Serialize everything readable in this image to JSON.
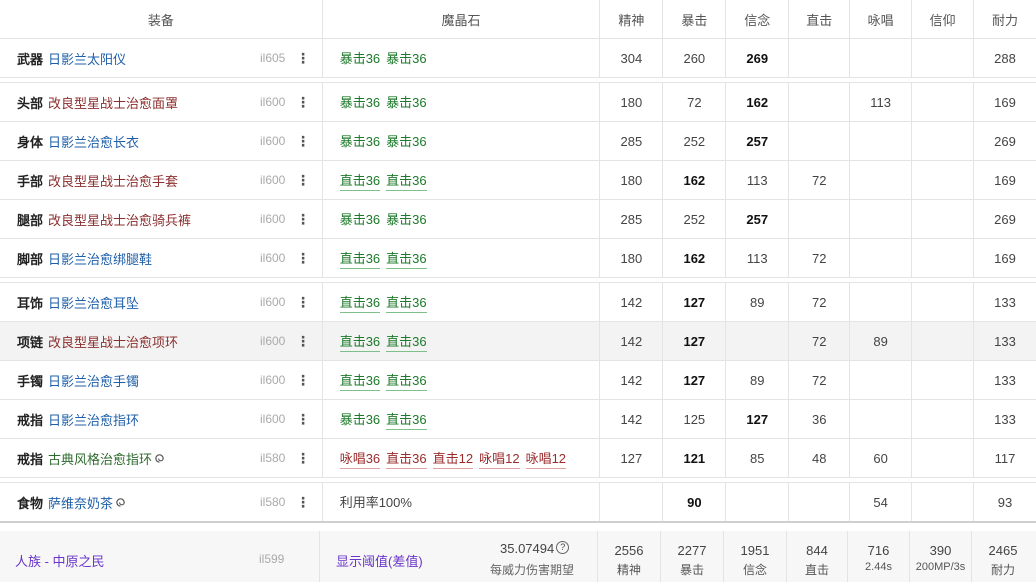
{
  "header": {
    "gear": "装备",
    "materia": "魔晶石",
    "stats": [
      "精神",
      "暴击",
      "信念",
      "直击",
      "咏唱",
      "信仰",
      "耐力"
    ]
  },
  "rows": [
    {
      "slot": "武器",
      "name": "日影兰太阳仪",
      "color": "blue",
      "ilvl": "il605",
      "materia": [
        {
          "t": "暴击36",
          "k": "crit"
        },
        {
          "t": "暴击36",
          "k": "crit"
        }
      ],
      "stats": [
        "304",
        "260",
        "269",
        "",
        "",
        "",
        "288"
      ],
      "bold": [
        2
      ]
    },
    {
      "slot": "头部",
      "name": "改良型星战士治愈面罩",
      "color": "red",
      "ilvl": "il600",
      "materia": [
        {
          "t": "暴击36",
          "k": "crit"
        },
        {
          "t": "暴击36",
          "k": "crit"
        }
      ],
      "stats": [
        "180",
        "72",
        "162",
        "",
        "113",
        "",
        "169"
      ],
      "bold": [
        2
      ]
    },
    {
      "slot": "身体",
      "name": "日影兰治愈长衣",
      "color": "blue",
      "ilvl": "il600",
      "materia": [
        {
          "t": "暴击36",
          "k": "crit"
        },
        {
          "t": "暴击36",
          "k": "crit"
        }
      ],
      "stats": [
        "285",
        "252",
        "257",
        "",
        "",
        "",
        "269"
      ],
      "bold": [
        2
      ]
    },
    {
      "slot": "手部",
      "name": "改良型星战士治愈手套",
      "color": "red",
      "ilvl": "il600",
      "materia": [
        {
          "t": "直击36",
          "k": "dh"
        },
        {
          "t": "直击36",
          "k": "dh"
        }
      ],
      "stats": [
        "180",
        "162",
        "113",
        "72",
        "",
        "",
        "169"
      ],
      "bold": [
        1
      ]
    },
    {
      "slot": "腿部",
      "name": "改良型星战士治愈骑兵裤",
      "color": "red",
      "ilvl": "il600",
      "materia": [
        {
          "t": "暴击36",
          "k": "crit"
        },
        {
          "t": "暴击36",
          "k": "crit"
        }
      ],
      "stats": [
        "285",
        "252",
        "257",
        "",
        "",
        "",
        "269"
      ],
      "bold": [
        2
      ]
    },
    {
      "slot": "脚部",
      "name": "日影兰治愈绑腿鞋",
      "color": "blue",
      "ilvl": "il600",
      "materia": [
        {
          "t": "直击36",
          "k": "dh"
        },
        {
          "t": "直击36",
          "k": "dh"
        }
      ],
      "stats": [
        "180",
        "162",
        "113",
        "72",
        "",
        "",
        "169"
      ],
      "bold": [
        1
      ]
    },
    {
      "slot": "耳饰",
      "name": "日影兰治愈耳坠",
      "color": "blue",
      "ilvl": "il600",
      "materia": [
        {
          "t": "直击36",
          "k": "dh"
        },
        {
          "t": "直击36",
          "k": "dh"
        }
      ],
      "stats": [
        "142",
        "127",
        "89",
        "72",
        "",
        "",
        "133"
      ],
      "bold": [
        1
      ]
    },
    {
      "slot": "项链",
      "name": "改良型星战士治愈项环",
      "color": "red",
      "ilvl": "il600",
      "materia": [
        {
          "t": "直击36",
          "k": "dh"
        },
        {
          "t": "直击36",
          "k": "dh"
        }
      ],
      "stats": [
        "142",
        "127",
        "",
        "72",
        "89",
        "",
        "133"
      ],
      "bold": [
        1
      ],
      "highlight": true
    },
    {
      "slot": "手镯",
      "name": "日影兰治愈手镯",
      "color": "blue",
      "ilvl": "il600",
      "materia": [
        {
          "t": "直击36",
          "k": "dh"
        },
        {
          "t": "直击36",
          "k": "dh"
        }
      ],
      "stats": [
        "142",
        "127",
        "89",
        "72",
        "",
        "",
        "133"
      ],
      "bold": [
        1
      ]
    },
    {
      "slot": "戒指",
      "name": "日影兰治愈指环",
      "color": "blue",
      "ilvl": "il600",
      "materia": [
        {
          "t": "暴击36",
          "k": "crit"
        },
        {
          "t": "直击36",
          "k": "dh"
        }
      ],
      "stats": [
        "142",
        "125",
        "127",
        "36",
        "",
        "",
        "133"
      ],
      "bold": [
        2
      ]
    },
    {
      "slot": "戒指",
      "name": "古典风格治愈指环",
      "color": "green",
      "ilvl": "il580",
      "swirl": true,
      "materia": [
        {
          "t": "咏唱36",
          "k": "red"
        },
        {
          "t": "直击36",
          "k": "red"
        },
        {
          "t": "直击12",
          "k": "red"
        },
        {
          "t": "咏唱12",
          "k": "red"
        },
        {
          "t": "咏唱12",
          "k": "red"
        }
      ],
      "stats": [
        "127",
        "121",
        "85",
        "48",
        "60",
        "",
        "117"
      ],
      "bold": [
        1
      ]
    }
  ],
  "food": {
    "slot": "食物",
    "name": "萨维奈奶茶",
    "ilvl": "il580",
    "materia_text": "利用率100%",
    "stats": [
      "",
      "90",
      "",
      "",
      "54",
      "",
      "93"
    ],
    "bold": [
      1
    ]
  },
  "footer": {
    "race": "人族 - 中原之民",
    "ilvl": "il599",
    "toggle": "显示阈值(差值)",
    "damage_value": "35.07494",
    "damage_label": "每威力伤害期望",
    "totals": [
      {
        "v": "2556",
        "l": "精神"
      },
      {
        "v": "2277",
        "l": "暴击"
      },
      {
        "v": "1951",
        "l": "信念"
      },
      {
        "v": "844",
        "l": "直击"
      },
      {
        "v": "716",
        "l": "2.44s"
      },
      {
        "v": "390",
        "l": "200MP/3s"
      },
      {
        "v": "2465",
        "l": "耐力"
      }
    ]
  }
}
